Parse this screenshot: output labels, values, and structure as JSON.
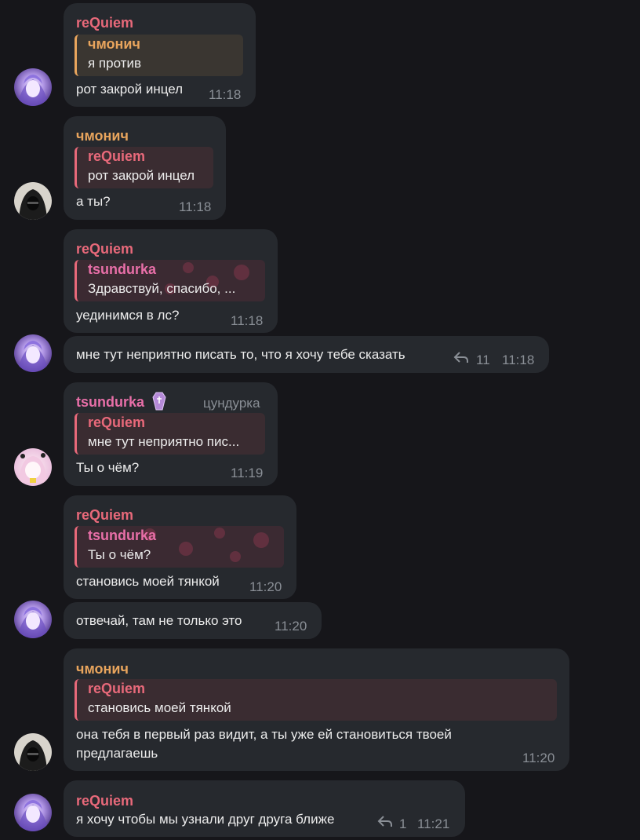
{
  "colors": {
    "background": "#16161a",
    "bubble": "#26292e",
    "requiem": "#e8697a",
    "chmonich": "#e9a55d",
    "tsundurka": "#e86fa8",
    "reply_bg_requiem": "#3a2c31",
    "reply_bg_chmonich": "#3a3631",
    "reply_bg_tsundurka": "#3b2a32",
    "meta": "#8a8f96"
  },
  "messages": [
    {
      "sender": "reQuiem",
      "reply_to": {
        "name": "чмонич",
        "text": "я против"
      },
      "text": "рот закрой инцел",
      "time": "11:18"
    },
    {
      "sender": "чмонич",
      "reply_to": {
        "name": "reQuiem",
        "text": "рот закрой инцел"
      },
      "text": "а ты?",
      "time": "11:18"
    },
    {
      "sender": "reQuiem",
      "reply_to": {
        "name": "tsundurka",
        "text": "Здравствуй, спасибо, ..."
      },
      "text": "уединимся в лс?",
      "time": "11:18"
    },
    {
      "sender": "",
      "text": "мне тут неприятно писать то, что я хочу тебе сказать",
      "reply_count": "11",
      "time": "11:18"
    },
    {
      "sender": "tsundurka",
      "tag": "цундурка",
      "reply_to": {
        "name": "reQuiem",
        "text": "мне тут неприятно пис..."
      },
      "text": "Ты о чём?",
      "time": "11:19"
    },
    {
      "sender": "reQuiem",
      "reply_to": {
        "name": "tsundurka",
        "text": "Ты о чём?"
      },
      "text": "становись моей тянкой",
      "time": "11:20"
    },
    {
      "sender": "",
      "text": "отвечай, там не только это",
      "time": "11:20"
    },
    {
      "sender": "чмонич",
      "reply_to": {
        "name": "reQuiem",
        "text": "становись моей тянкой"
      },
      "text_line1": "она тебя в первый раз видит, а ты уже ей становиться твоей",
      "text_line2": "предлагаешь",
      "time": "11:20"
    },
    {
      "sender": "reQuiem",
      "text": "я хочу чтобы мы узнали друг друга ближе",
      "reply_count": "1",
      "time": "11:21"
    }
  ]
}
